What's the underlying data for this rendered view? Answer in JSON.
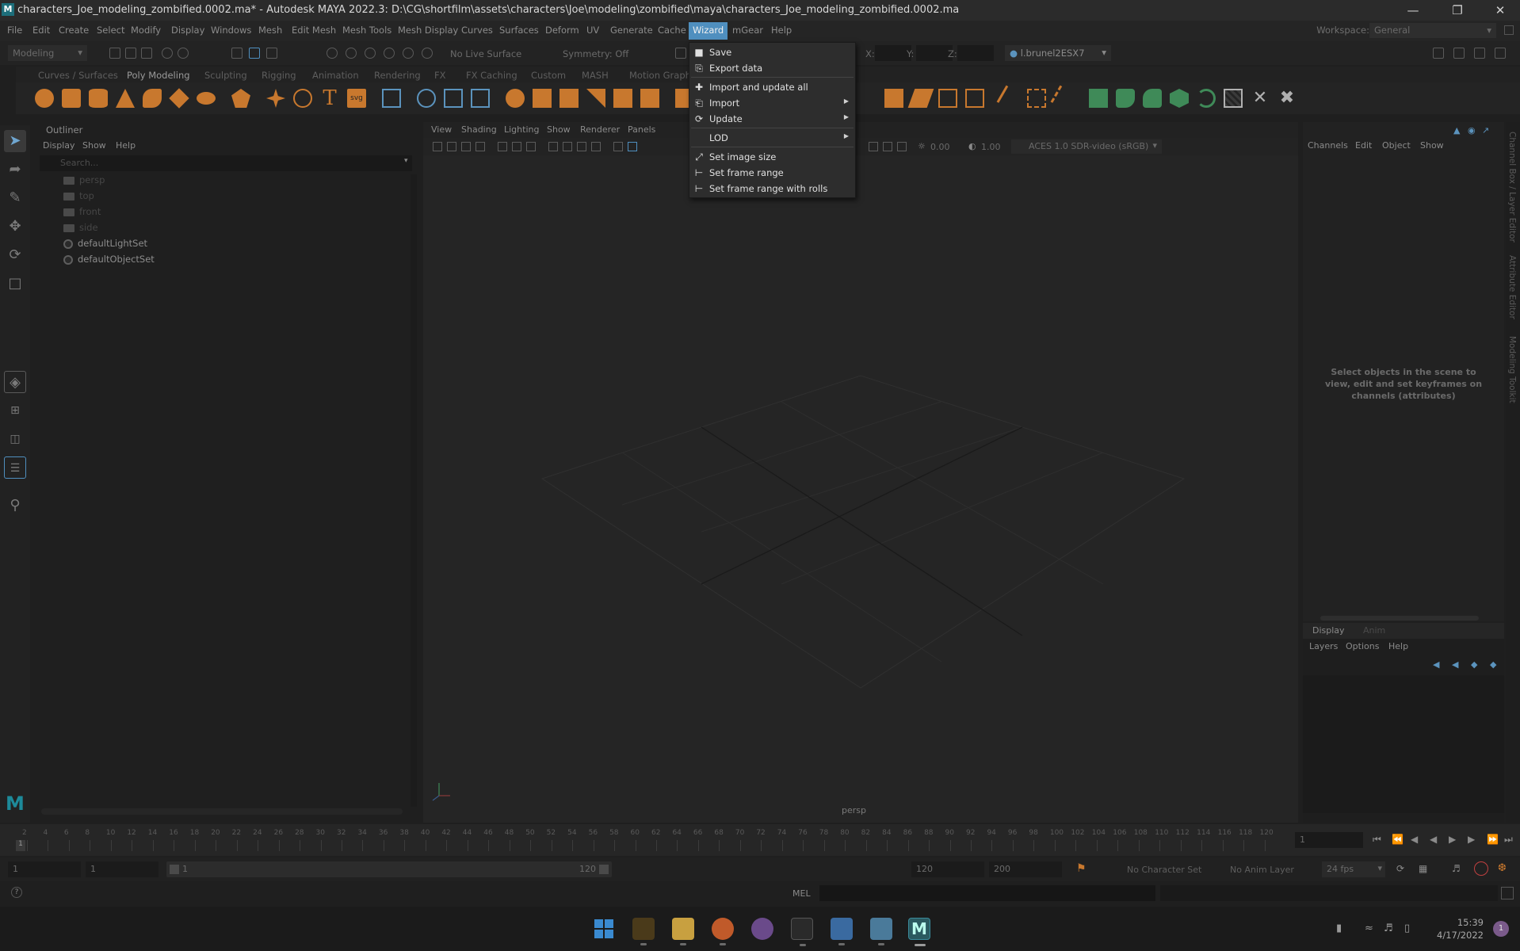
{
  "window": {
    "title": "characters_Joe_modeling_zombified.0002.ma* - Autodesk MAYA 2022.3: D:\\CG\\shortfilm\\assets\\characters\\Joe\\modeling\\zombified\\maya\\characters_Joe_modeling_zombified.0002.ma",
    "logo": "M"
  },
  "menubar": {
    "items": [
      "File",
      "Edit",
      "Create",
      "Select",
      "Modify",
      "Display",
      "Windows",
      "Mesh",
      "Edit Mesh",
      "Mesh Tools",
      "Mesh Display",
      "Curves",
      "Surfaces",
      "Deform",
      "UV",
      "Generate",
      "Cache",
      "Wizard",
      "mGear",
      "Help"
    ],
    "active": "Wizard",
    "workspace_label": "Workspace:",
    "workspace_value": "General"
  },
  "statusline": {
    "mode": "Modeling",
    "live_surface": "No Live Surface",
    "symmetry": "Symmetry: Off",
    "x_label": "X:",
    "y_label": "Y:",
    "z_label": "Z:",
    "user": "l.brunel2ESX7"
  },
  "shelf": {
    "tabs": [
      "Curves / Surfaces",
      "Poly Modeling",
      "Sculpting",
      "Rigging",
      "Animation",
      "Rendering",
      "FX",
      "FX Caching",
      "Custom",
      "MASH",
      "Motion Graphics"
    ],
    "active": "Poly Modeling",
    "text_icon_t": "T",
    "text_icon_svg": "svg"
  },
  "outliner": {
    "title": "Outliner",
    "menu": [
      "Display",
      "Show",
      "Help"
    ],
    "search_placeholder": "Search...",
    "items": [
      {
        "label": "persp",
        "type": "camera",
        "dim": true
      },
      {
        "label": "top",
        "type": "camera",
        "dim": true
      },
      {
        "label": "front",
        "type": "camera",
        "dim": true
      },
      {
        "label": "side",
        "type": "camera",
        "dim": true
      },
      {
        "label": "defaultLightSet",
        "type": "set",
        "dim": false
      },
      {
        "label": "defaultObjectSet",
        "type": "set",
        "dim": false
      }
    ]
  },
  "viewport": {
    "menu": [
      "View",
      "Shading",
      "Lighting",
      "Show",
      "Renderer",
      "Panels"
    ],
    "exposure": "0.00",
    "gamma": "1.00",
    "colorspace": "ACES 1.0 SDR-video (sRGB)",
    "camera_label": "persp"
  },
  "wizard_menu": {
    "items": [
      {
        "label": "Save",
        "icon": "save-icon",
        "glyph": "■",
        "submenu": false
      },
      {
        "label": "Export data",
        "icon": "export-icon",
        "glyph": "⎘",
        "submenu": false
      },
      {
        "label": "Import and update all",
        "icon": "import-update-all-icon",
        "glyph": "✚",
        "submenu": false
      },
      {
        "label": "Import",
        "icon": "import-icon",
        "glyph": "⎗",
        "submenu": true
      },
      {
        "label": "Update",
        "icon": "refresh-icon",
        "glyph": "⟳",
        "submenu": true
      },
      {
        "label": "LOD",
        "icon": "",
        "glyph": "",
        "submenu": true
      },
      {
        "label": "Set image size",
        "icon": "resize-icon",
        "glyph": "⤢",
        "submenu": false
      },
      {
        "label": "Set frame range",
        "icon": "frame-range-icon",
        "glyph": "⊢",
        "submenu": false
      },
      {
        "label": "Set frame range with rolls",
        "icon": "frame-range-rolls-icon",
        "glyph": "⊢",
        "submenu": false
      }
    ]
  },
  "channelbox": {
    "menu": [
      "Channels",
      "Edit",
      "Object",
      "Show"
    ],
    "hint": "Select objects in the scene to view, edit and set keyframes on channels (attributes)"
  },
  "layereditor": {
    "tabs": [
      "Display",
      "Anim"
    ],
    "menu": [
      "Layers",
      "Options",
      "Help"
    ]
  },
  "side_tabs": [
    "Channel Box / Layer Editor",
    "Attribute Editor",
    "Modeling Toolkit"
  ],
  "timeline": {
    "ticks": [
      "2",
      "4",
      "6",
      "8",
      "10",
      "12",
      "14",
      "16",
      "18",
      "20",
      "22",
      "24",
      "26",
      "28",
      "30",
      "32",
      "34",
      "36",
      "38",
      "40",
      "42",
      "44",
      "46",
      "48",
      "50",
      "52",
      "54",
      "56",
      "58",
      "60",
      "62",
      "64",
      "66",
      "68",
      "70",
      "72",
      "74",
      "76",
      "78",
      "80",
      "82",
      "84",
      "86",
      "88",
      "90",
      "92",
      "94",
      "96",
      "98",
      "100",
      "102",
      "104",
      "106",
      "108",
      "110",
      "112",
      "114",
      "116",
      "118",
      "120"
    ],
    "current_frame_marker": "1",
    "current_frame": "1"
  },
  "range": {
    "start": "1",
    "anim_start": "1",
    "slider_start": "1",
    "slider_end": "120",
    "anim_end": "120",
    "end": "200",
    "character_set": "No Character Set",
    "anim_layer": "No Anim Layer",
    "fps": "24 fps"
  },
  "cmdline": {
    "lang": "MEL"
  },
  "taskbar": {
    "time": "15:39",
    "date": "4/17/2022",
    "notifications": "1"
  },
  "colors": {
    "menu_highlight": "#4f8fbf",
    "shelf_orange": "#c8782e",
    "shelf_green": "#3f8a58",
    "shelf_blue": "#5b93bd"
  }
}
